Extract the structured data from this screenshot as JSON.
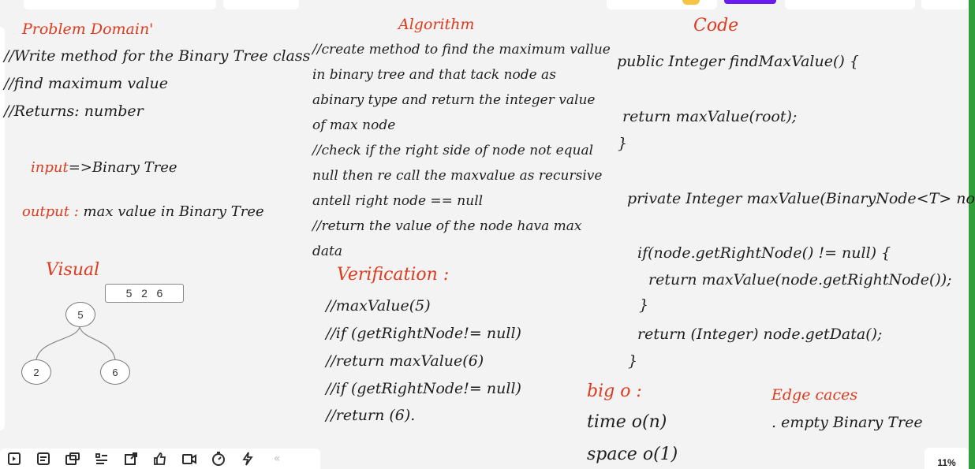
{
  "headings": {
    "problem_domain": "Problem Domain'",
    "algorithm": "Algorithm",
    "code": "Code",
    "visual": "Visual",
    "verification": "Verification :",
    "big_o": "big o :",
    "edge_cases": "Edge caces"
  },
  "problem": {
    "line1": "//Write method for the Binary Tree class",
    "line2": "//find maximum value",
    "line3": "//Returns: number",
    "input_label": "input",
    "input_value": "=>Binary Tree",
    "output_label": "output :",
    "output_value": "max value in Binary Tree"
  },
  "algorithm_lines": [
    "//create method to find the maximum vallue",
    "in binary tree and  that tack node as",
    "abinary type and return the integer value",
    "of max node",
    "//check if  the right  side of node not equal",
    "null  then re call the maxvalue as recursive",
    "antell right node == null",
    "//return the value of the node hava max",
    "data"
  ],
  "code_lines": [
    "public Integer findMaxValue() {",
    "return maxValue(root);",
    "}",
    "private Integer maxValue(BinaryNode<T> node ) {",
    "if(node.getRightNode() != null) {",
    "return maxValue(node.getRightNode());",
    "}",
    "return (Integer) node.getData();",
    "}"
  ],
  "verification_lines": [
    "//maxValue(5)",
    "//if (getRightNode!= null)",
    "//return maxValue(6)",
    "//if (getRightNode!= null)",
    "//return (6)."
  ],
  "big_o": {
    "time": "time o(n)",
    "space": "space o(1)"
  },
  "edge_cases": {
    "item1": ". empty Binary Tree"
  },
  "visual": {
    "array_text": "5   2   6",
    "root": "5",
    "left": "2",
    "right": "6"
  },
  "toolbar": {
    "icons": [
      "embed-icon",
      "note-icon",
      "frame-icon",
      "list-icon",
      "resize-icon",
      "like-icon",
      "video-icon",
      "timer-icon",
      "lightning-icon",
      "collapse-icon"
    ],
    "zoom": "11%"
  },
  "colors": {
    "accent_red": "#e03a1e",
    "text": "#1e1e1e",
    "canvas": "#f3f3f3",
    "scroll_green": "#2e9f3b",
    "purple": "#6a1bf0"
  }
}
